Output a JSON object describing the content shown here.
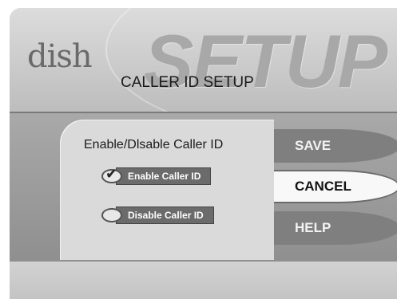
{
  "header": {
    "logo_text": "dish",
    "big_title": "SETUP",
    "subtitle": "CALLER ID SETUP"
  },
  "panel": {
    "title": "Enable/Dlsable Caller ID",
    "options": [
      {
        "label": "Enable Caller ID",
        "selected": true
      },
      {
        "label": "Disable Caller ID",
        "selected": false
      }
    ]
  },
  "buttons": {
    "save": "SAVE",
    "cancel": "CANCEL",
    "help": "HELP",
    "focused": "cancel"
  },
  "icons": {
    "selected_marker": "checkmark-icon",
    "unselected_marker": "radio-oval-icon"
  }
}
